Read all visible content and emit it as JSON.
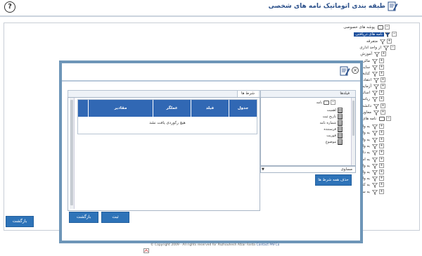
{
  "header": {
    "title": "طبقه بندی اتوماتیک نامه های شخصی",
    "help": "?"
  },
  "tree": {
    "nodes": [
      {
        "label": "پوشه های خصوصی"
      },
      {
        "label": "نامه های دریافتی"
      },
      {
        "label": "متفرقه"
      },
      {
        "label": "از واحد اداری"
      },
      {
        "label": "آموزش"
      },
      {
        "label": "مالی"
      },
      {
        "label": "سایت"
      },
      {
        "label": "کتابخانه"
      },
      {
        "label": "انتقادات"
      },
      {
        "label": "آزمایشگاه"
      },
      {
        "label": "اساتید"
      },
      {
        "label": "ریاست"
      },
      {
        "label": "دانشجویان"
      },
      {
        "label": "معاون آموزشی"
      },
      {
        "label": "نامه های ارسالی"
      },
      {
        "label": "به واحد آموزش"
      },
      {
        "label": "به واحد مالی"
      },
      {
        "label": "به واحد اطلاعات و سایت"
      },
      {
        "label": "به واحد معاون آموزشی"
      },
      {
        "label": "به دانشجویان"
      },
      {
        "label": "به اساتید"
      },
      {
        "label": "به واحد ریاست"
      },
      {
        "label": "به واحد بایگانی"
      },
      {
        "label": "به واحد آزمایشگاه"
      },
      {
        "label": "به کتابخانه"
      },
      {
        "label": "به سایت"
      }
    ]
  },
  "main": {
    "back_label": "بازگشت"
  },
  "modal": {
    "tab_fields": "فیلدها",
    "tab_conditions": "شرط ها",
    "root": "نامه",
    "fields": [
      "اهمیت",
      "تاریخ ثبت",
      "شماره نامه",
      "فرستنده",
      "فوریت",
      "موضوع"
    ],
    "operator": "مساوی",
    "delete_all": "حذف همه شرط ها",
    "columns": [
      "جدول",
      "فیلد",
      "عملگر",
      "مقادیر"
    ],
    "empty_message": "هیچ رکوردی یافت نشد",
    "save_label": "ثبت",
    "back_label": "بازگشت"
  },
  "footer": {
    "copyright": "© Copyright 2009 - All rights reserved for Pazhouhesh Afzar Farda",
    "contact": "Contact PAFCo"
  }
}
